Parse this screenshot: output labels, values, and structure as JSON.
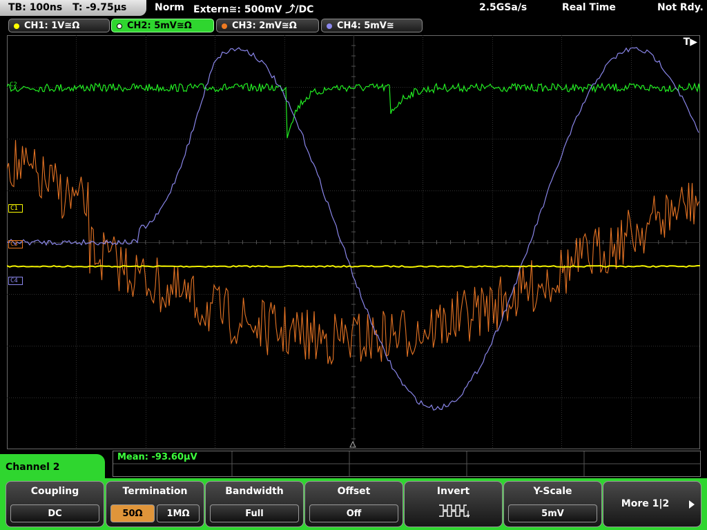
{
  "status": {
    "timebase": "TB: 100ns",
    "trigger_time": "T: -9.75µs",
    "mode": "Norm",
    "trigger_source": "Extern≅: 500mV ⤴/DC",
    "sample_rate": "2.5GSa/s",
    "acq_mode": "Real Time",
    "state": "Not Rdy."
  },
  "channels": [
    {
      "label": "CH1: 1V≅Ω",
      "color": "#ffff00"
    },
    {
      "label": "CH2: 5mV≅Ω",
      "color": "#00ee00",
      "active": true
    },
    {
      "label": "CH3: 2mV≅Ω",
      "color": "#ee7a22"
    },
    {
      "label": "CH4: 5mV≅",
      "color": "#8c88ee"
    }
  ],
  "plot": {
    "trigger_marker": "T▶",
    "markers": [
      "C1",
      "C2",
      "C3",
      "C4"
    ]
  },
  "measurement": {
    "text": "Mean: -93.60µV"
  },
  "menu": {
    "title": "Channel 2",
    "softkeys": {
      "coupling": {
        "title": "Coupling",
        "value": "DC"
      },
      "termination": {
        "title": "Termination",
        "options": [
          "50Ω",
          "1MΩ"
        ],
        "selected": "50Ω"
      },
      "bandwidth": {
        "title": "Bandwidth",
        "value": "Full"
      },
      "offset": {
        "title": "Offset",
        "value": "Off"
      },
      "invert": {
        "title": "Invert",
        "icon": "invert-waveform-icon"
      },
      "yscale": {
        "title": "Y-Scale",
        "value": "5mV"
      },
      "more": {
        "label": "More 1|2"
      }
    }
  },
  "colors": {
    "grid": "#3a3a3a",
    "menu_accent": "#2fd62f",
    "selected": "#e0953a"
  }
}
